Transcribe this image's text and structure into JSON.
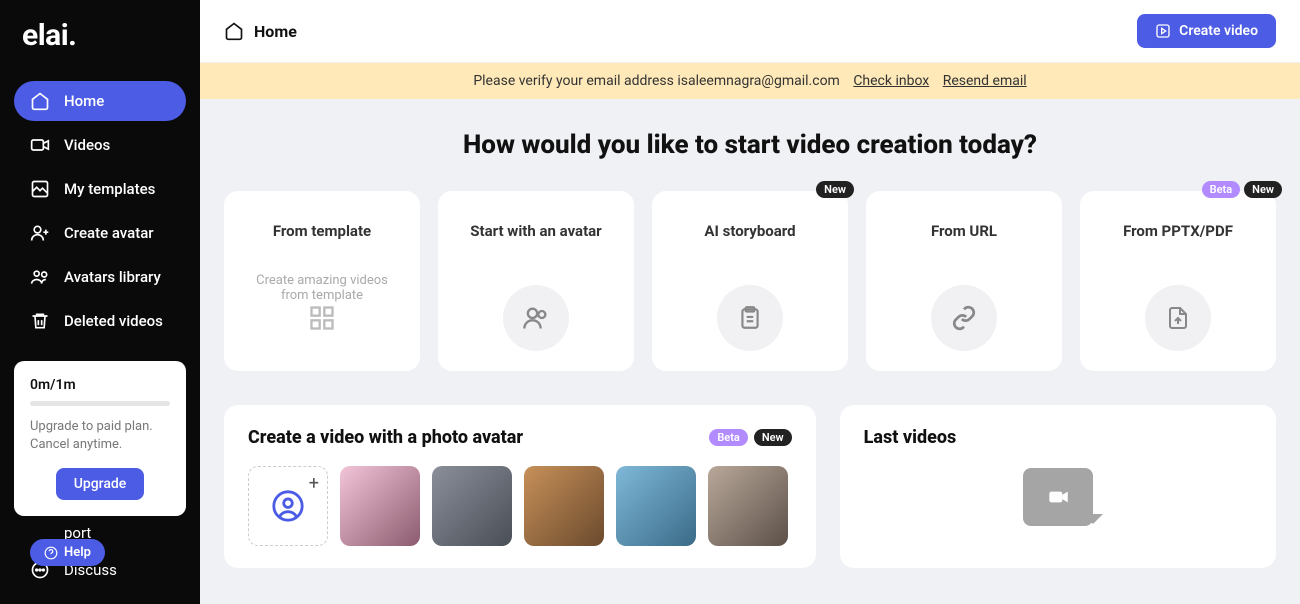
{
  "logo": "elai.",
  "nav": {
    "home": "Home",
    "videos": "Videos",
    "templates": "My templates",
    "create_avatar": "Create avatar",
    "avatars_library": "Avatars library",
    "deleted": "Deleted videos"
  },
  "usage": {
    "counter": "0m/1m",
    "text": "Upgrade to paid plan. Cancel anytime.",
    "button": "Upgrade"
  },
  "help": "Help",
  "bottom": {
    "support": "port",
    "discuss": "Discuss"
  },
  "topbar": {
    "title": "Home",
    "create": "Create video"
  },
  "banner": {
    "text": "Please verify your email address isaleemnagra@gmail.com",
    "check": "Check inbox",
    "resend": "Resend email"
  },
  "headline": "How would you like to start video creation today?",
  "cards": [
    {
      "title": "From template",
      "sub": "Create amazing videos from template",
      "icon": "grid",
      "badges": []
    },
    {
      "title": "Start with an avatar",
      "sub": "",
      "icon": "people",
      "badges": []
    },
    {
      "title": "AI storyboard",
      "sub": "",
      "icon": "clipboard",
      "badges": [
        "New"
      ]
    },
    {
      "title": "From URL",
      "sub": "",
      "icon": "link",
      "badges": []
    },
    {
      "title": "From PPTX/PDF",
      "sub": "",
      "icon": "file",
      "badges": [
        "Beta",
        "New"
      ]
    }
  ],
  "photo_panel": {
    "title": "Create a video with a photo avatar",
    "badges": [
      "Beta",
      "New"
    ]
  },
  "last_panel": {
    "title": "Last videos"
  }
}
